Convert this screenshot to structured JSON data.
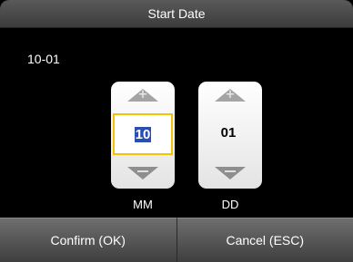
{
  "title": "Start Date",
  "current_value": "10-01",
  "month": {
    "value": "10",
    "unit": "MM"
  },
  "day": {
    "value": "01",
    "unit": "DD"
  },
  "buttons": {
    "confirm": "Confirm (OK)",
    "cancel": "Cancel (ESC)"
  },
  "colors": {
    "selection_border": "#f5c300",
    "selection_highlight": "#2a4fb0"
  }
}
